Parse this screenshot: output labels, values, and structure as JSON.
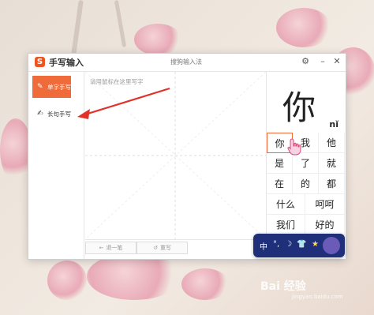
{
  "window": {
    "app_title": "手写输入",
    "center_title": "搜狗输入法",
    "logo": "S",
    "settings_icon": "gear-icon",
    "minimize_icon": "minimize-icon",
    "close_icon": "close-icon"
  },
  "sidebar": {
    "items": [
      {
        "label": "单字手写",
        "icon": "pencil-icon",
        "active": true
      },
      {
        "label": "长句手写",
        "icon": "write-icon",
        "active": false
      }
    ]
  },
  "canvas": {
    "hint": "请用鼠标在这里写字",
    "buttons": [
      {
        "label": "退一笔",
        "icon": "arrow-left-icon"
      },
      {
        "label": "重写",
        "icon": "refresh-icon"
      }
    ]
  },
  "candidates": {
    "big_char": "你",
    "pinyin": "nǐ",
    "rows": [
      [
        "你",
        "我",
        "他"
      ],
      [
        "是",
        "了",
        "就"
      ],
      [
        "在",
        "的",
        "都"
      ],
      [
        "什么",
        "呵呵"
      ],
      [
        "我们",
        "好的"
      ]
    ]
  },
  "widget": {
    "items": [
      "中",
      "°,",
      "☽",
      "👕",
      "★"
    ]
  },
  "watermark": {
    "brand": "Bai 经验",
    "url": "jingyan.baidu.com"
  },
  "colors": {
    "accent": "#f06b3a",
    "widget_bg": "#1f2f7a"
  }
}
